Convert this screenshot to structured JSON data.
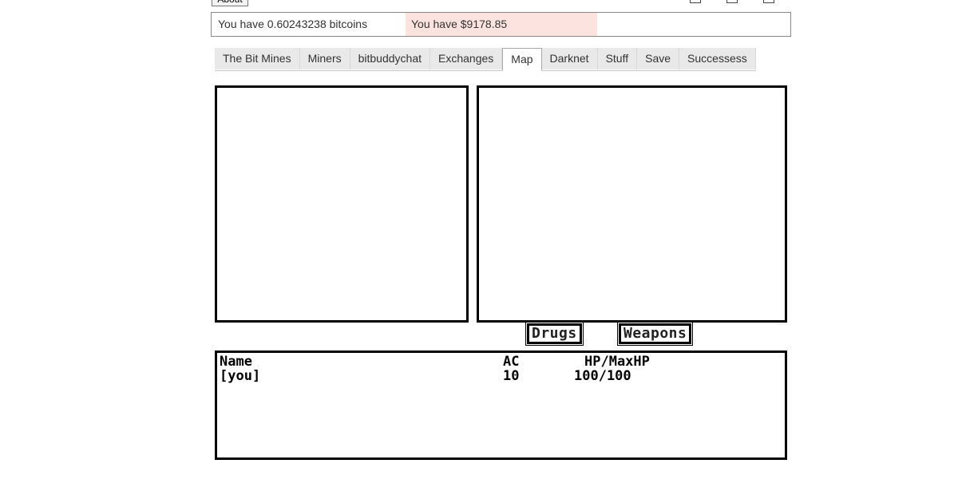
{
  "topbar": {
    "about_label": "About"
  },
  "balance": {
    "btc_text": "You have 0.60243238 bitcoins",
    "usd_text": "You have $9178.85",
    "usd_bg": "#fde3df"
  },
  "tabs": [
    {
      "label": "The Bit Mines"
    },
    {
      "label": "Miners"
    },
    {
      "label": "bitbuddychat"
    },
    {
      "label": "Exchanges"
    },
    {
      "label": "Map"
    },
    {
      "label": "Darknet"
    },
    {
      "label": "Stuff"
    },
    {
      "label": "Save"
    },
    {
      "label": "Successess"
    }
  ],
  "active_tab": "Map",
  "buttons": {
    "drugs": "Drugs",
    "weapons": "Weapons"
  },
  "party": {
    "headers": {
      "name": "Name",
      "ac": "AC",
      "hp": "HP/MaxHP"
    },
    "rows": [
      {
        "name": "[you]",
        "ac": "10",
        "hp": "100/100"
      }
    ]
  }
}
